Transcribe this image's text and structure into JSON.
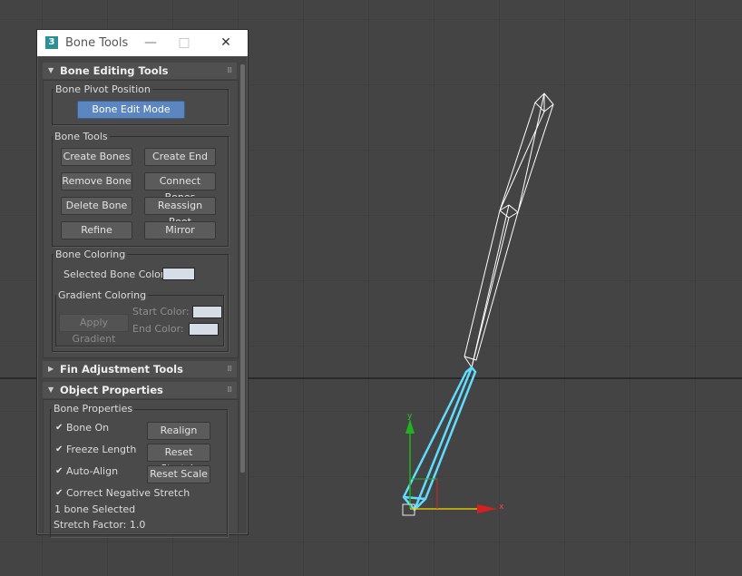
{
  "window": {
    "app_icon": "3",
    "title": "Bone Tools",
    "minimize": "—",
    "maximize": "□",
    "close": "✕"
  },
  "rollouts": {
    "bone_editing": {
      "title": "Bone Editing Tools",
      "pivot_group": {
        "title": "Bone Pivot Position",
        "edit_mode": "Bone Edit Mode"
      },
      "tools_group": {
        "title": "Bone Tools",
        "create_bones": "Create Bones",
        "create_end": "Create End",
        "remove_bone": "Remove Bone",
        "connect_bones": "Connect Bones",
        "delete_bone": "Delete Bone",
        "reassign_root": "Reassign Root",
        "refine": "Refine",
        "mirror": "Mirror"
      },
      "coloring_group": {
        "title": "Bone Coloring",
        "selected_color_label": "Selected Bone Color:",
        "gradient_group": {
          "title": "Gradient Coloring",
          "apply_gradient": "Apply Gradient",
          "start_color_label": "Start Color:",
          "end_color_label": "End Color:"
        }
      }
    },
    "fin_adjustment": {
      "title": "Fin Adjustment Tools"
    },
    "object_properties": {
      "title": "Object Properties",
      "bone_props_group": {
        "title": "Bone Properties",
        "bone_on": "Bone On",
        "freeze_length": "Freeze Length",
        "auto_align": "Auto-Align",
        "correct_negative_stretch": "Correct Negative Stretch",
        "realign": "Realign",
        "reset_stretch": "Reset Stretch",
        "reset_scale": "Reset Scale",
        "selection_status": "1 bone Selected",
        "stretch_factor": "Stretch Factor: 1.0"
      }
    }
  },
  "gizmo": {
    "axis_x": "x",
    "axis_y": "y"
  },
  "colors": {
    "selected_bone": "#5fdcff",
    "axis_x": "#d42020",
    "axis_y": "#20b020",
    "swatch": "#d7dde6",
    "accent_button": "#5b86c0"
  },
  "checkbox_state": {
    "bone_on": true,
    "freeze_length": true,
    "auto_align": true,
    "correct_negative_stretch": true
  }
}
